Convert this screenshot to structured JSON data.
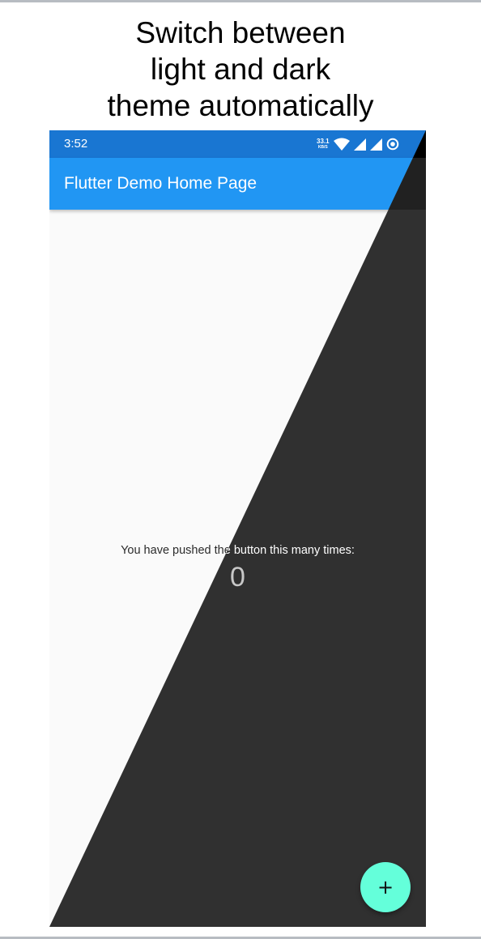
{
  "caption": {
    "lines": [
      "Switch between",
      "light and dark",
      "theme automatically"
    ]
  },
  "status_bar": {
    "time": "3:52",
    "net_speed_value": "33.1",
    "net_speed_unit": "KB/S",
    "icons": [
      "wifi-icon",
      "cell-signal-icon",
      "cell-signal-icon",
      "battery-saver-icon"
    ]
  },
  "app_bar": {
    "title": "Flutter Demo Home Page"
  },
  "body": {
    "caption": "You have pushed the button this many times:",
    "counter": "0"
  },
  "fab": {
    "icon": "plus-icon",
    "glyph": "+"
  },
  "colors": {
    "light_primary": "#2196f3",
    "light_status": "#1976d2",
    "light_background": "#fafafa",
    "dark_background": "#303030",
    "dark_appbar": "#212121",
    "accent": "#64ffda"
  }
}
